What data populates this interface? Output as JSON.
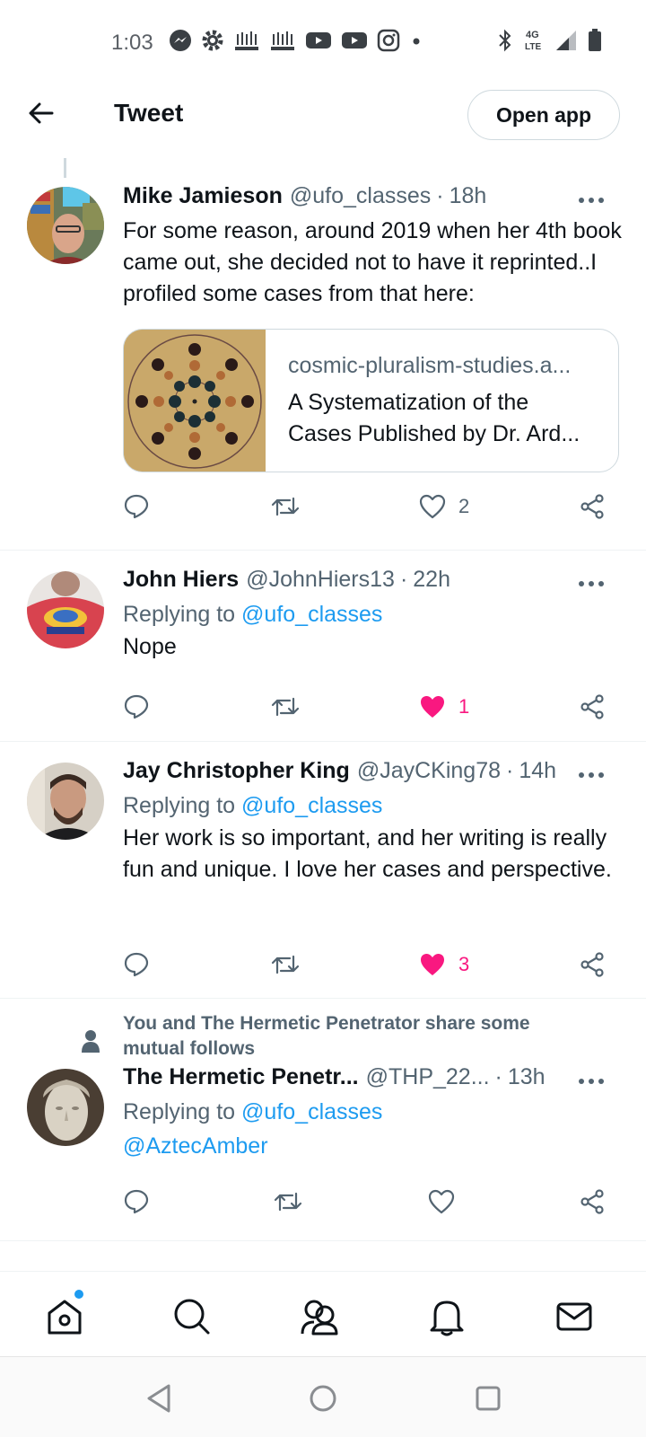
{
  "status_bar": {
    "time": "1:03",
    "network": "4G LTE",
    "icons": [
      "messenger-icon",
      "gear-icon",
      "app-icon",
      "app-icon",
      "youtube-icon",
      "youtube-icon",
      "instagram-icon",
      "dot-icon",
      "bluetooth-icon",
      "signal-icon",
      "battery-icon"
    ]
  },
  "header": {
    "title": "Tweet",
    "open_app_label": "Open app"
  },
  "tweets": [
    {
      "name": "Mike Jamieson",
      "handle": "@ufo_classes",
      "time": "18h",
      "text": "For some reason, around 2019 when her 4th book came out, she decided not to have it reprinted..I profiled some cases from that here:",
      "card": {
        "domain": "cosmic-pluralism-studies.a...",
        "title": "A Systematization of the Cases Published by Dr. Ard..."
      },
      "likes": "2",
      "liked": false
    },
    {
      "name": "John Hiers",
      "handle": "@JohnHiers13",
      "time": "22h",
      "replying_prefix": "Replying to",
      "replying_to": "@ufo_classes",
      "text": "Nope",
      "likes": "1",
      "liked": true
    },
    {
      "name": "Jay Christopher King",
      "handle": "@JayCKing78",
      "time": "14h",
      "replying_prefix": "Replying to",
      "replying_to": "@ufo_classes",
      "text": "Her work is so important, and her writing is really fun and unique. I love her cases and perspective.",
      "likes": "3",
      "liked": true
    },
    {
      "social_context": "You and The Hermetic Penetrator share some mutual follows",
      "name": "The Hermetic Penetr...",
      "handle": "@THP_22...",
      "time": "13h",
      "replying_prefix": "Replying to",
      "replying_to": "@ufo_classes",
      "mention": "@AztecAmber",
      "likes": "",
      "liked": false
    }
  ],
  "bottom_nav": [
    "home-icon",
    "search-icon",
    "communities-icon",
    "notifications-icon",
    "messages-icon"
  ],
  "colors": {
    "accent": "#1d9bf0",
    "like": "#f91880",
    "secondary_text": "#536471"
  }
}
